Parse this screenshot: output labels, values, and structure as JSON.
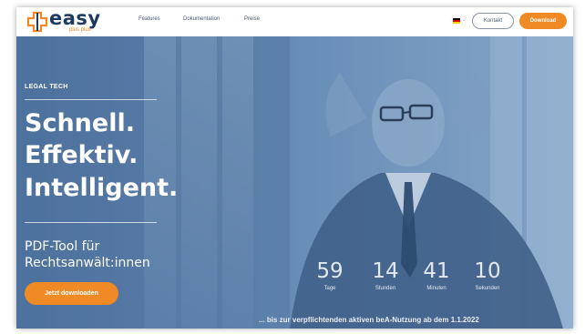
{
  "brand": {
    "logo_text": "easy",
    "logo_sub": "plus plus"
  },
  "nav": {
    "items": [
      "Features",
      "Dokumentation",
      "Preise"
    ]
  },
  "header": {
    "language_flag": "german-flag-icon",
    "language_caret": "⌄",
    "kontakt_label": "Kontakt",
    "download_label": "Download"
  },
  "hero": {
    "tagline": "LEGAL TECH",
    "headline": [
      "Schnell.",
      "Effektiv.",
      "Intelligent."
    ],
    "subline": [
      "PDF-Tool für",
      "Rechtsanwält:innen"
    ],
    "cta_label": "Jetzt downloaden"
  },
  "countdown": {
    "units": [
      {
        "value": "59",
        "label": "Tage"
      },
      {
        "value": "14",
        "label": "Stunden"
      },
      {
        "value": "41",
        "label": "Minuten"
      },
      {
        "value": "10",
        "label": "Sekunden"
      }
    ],
    "note": "... bis zur verpflichtenden aktiven beA-Nutzung ab dem 1.1.2022"
  },
  "colors": {
    "accent": "#f08a24",
    "brand_dark": "#1e3a5f",
    "hero_overlay": "#5b7fa8"
  }
}
